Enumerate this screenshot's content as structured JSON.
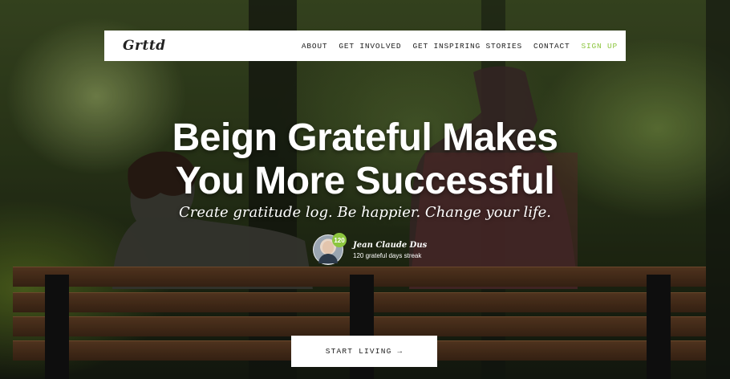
{
  "brand": {
    "name": "Grttd"
  },
  "nav": {
    "about": "ABOUT",
    "get_involved": "GET INVOLVED",
    "inspiring": "GET INSPIRING STORIES",
    "contact": "CONTACT",
    "signup": "SIGN UP"
  },
  "hero": {
    "title_line1": "Beign Grateful Makes",
    "title_line2": "You More Successful",
    "subtitle": "Create gratitude log. Be happier. Change your life."
  },
  "user": {
    "badge_count": "120",
    "name": "Jean Claude Dus",
    "streak": "120 grateful days streak"
  },
  "cta": {
    "label": "START LIVING →"
  },
  "colors": {
    "accent": "#8dc63f",
    "nav_bg": "#ffffff",
    "text_dark": "#222222"
  }
}
